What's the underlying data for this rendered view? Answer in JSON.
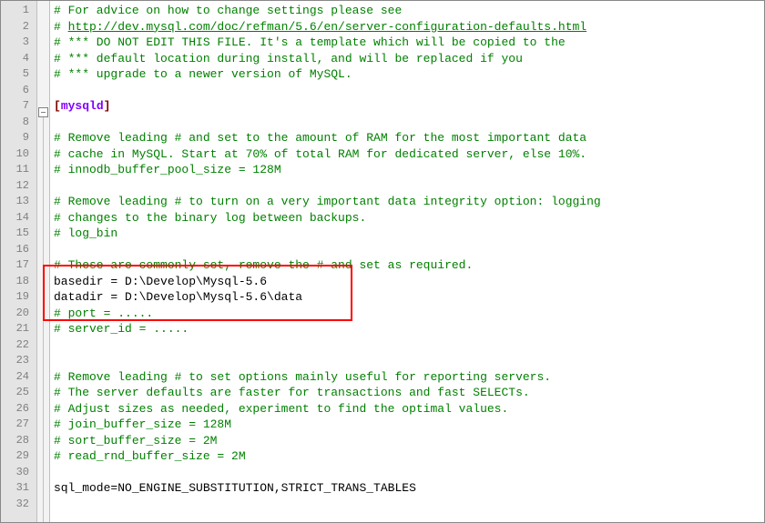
{
  "lines": [
    {
      "num": 1,
      "cls": "comment",
      "text": "# For advice on how to change settings please see"
    },
    {
      "num": 2,
      "cls": "link",
      "text": "# http://dev.mysql.com/doc/refman/5.6/en/server-configuration-defaults.html"
    },
    {
      "num": 3,
      "cls": "comment",
      "text": "# *** DO NOT EDIT THIS FILE. It's a template which will be copied to the"
    },
    {
      "num": 4,
      "cls": "comment",
      "text": "# *** default location during install, and will be replaced if you"
    },
    {
      "num": 5,
      "cls": "comment",
      "text": "# *** upgrade to a newer version of MySQL."
    },
    {
      "num": 6,
      "cls": "",
      "text": ""
    },
    {
      "num": 7,
      "cls": "section",
      "text": "[mysqld]"
    },
    {
      "num": 8,
      "cls": "",
      "text": ""
    },
    {
      "num": 9,
      "cls": "comment",
      "text": "# Remove leading # and set to the amount of RAM for the most important data"
    },
    {
      "num": 10,
      "cls": "comment",
      "text": "# cache in MySQL. Start at 70% of total RAM for dedicated server, else 10%."
    },
    {
      "num": 11,
      "cls": "comment",
      "text": "# innodb_buffer_pool_size = 128M"
    },
    {
      "num": 12,
      "cls": "",
      "text": ""
    },
    {
      "num": 13,
      "cls": "comment",
      "text": "# Remove leading # to turn on a very important data integrity option: logging"
    },
    {
      "num": 14,
      "cls": "comment",
      "text": "# changes to the binary log between backups."
    },
    {
      "num": 15,
      "cls": "comment",
      "text": "# log_bin"
    },
    {
      "num": 16,
      "cls": "",
      "text": ""
    },
    {
      "num": 17,
      "cls": "comment",
      "text": "# These are commonly set, remove the # and set as required."
    },
    {
      "num": 18,
      "cls": "key",
      "text": "basedir = D:\\Develop\\Mysql-5.6"
    },
    {
      "num": 19,
      "cls": "key",
      "text": "datadir = D:\\Develop\\Mysql-5.6\\data"
    },
    {
      "num": 20,
      "cls": "comment",
      "text": "# port = ....."
    },
    {
      "num": 21,
      "cls": "comment",
      "text": "# server_id = ....."
    },
    {
      "num": 22,
      "cls": "",
      "text": ""
    },
    {
      "num": 23,
      "cls": "",
      "text": ""
    },
    {
      "num": 24,
      "cls": "comment",
      "text": "# Remove leading # to set options mainly useful for reporting servers."
    },
    {
      "num": 25,
      "cls": "comment",
      "text": "# The server defaults are faster for transactions and fast SELECTs."
    },
    {
      "num": 26,
      "cls": "comment",
      "text": "# Adjust sizes as needed, experiment to find the optimal values."
    },
    {
      "num": 27,
      "cls": "comment",
      "text": "# join_buffer_size = 128M"
    },
    {
      "num": 28,
      "cls": "comment",
      "text": "# sort_buffer_size = 2M"
    },
    {
      "num": 29,
      "cls": "comment",
      "text": "# read_rnd_buffer_size = 2M"
    },
    {
      "num": 30,
      "cls": "",
      "text": ""
    },
    {
      "num": 31,
      "cls": "key",
      "text": "sql_mode=NO_ENGINE_SUBSTITUTION,STRICT_TRANS_TABLES"
    },
    {
      "num": 32,
      "cls": "",
      "text": ""
    }
  ]
}
